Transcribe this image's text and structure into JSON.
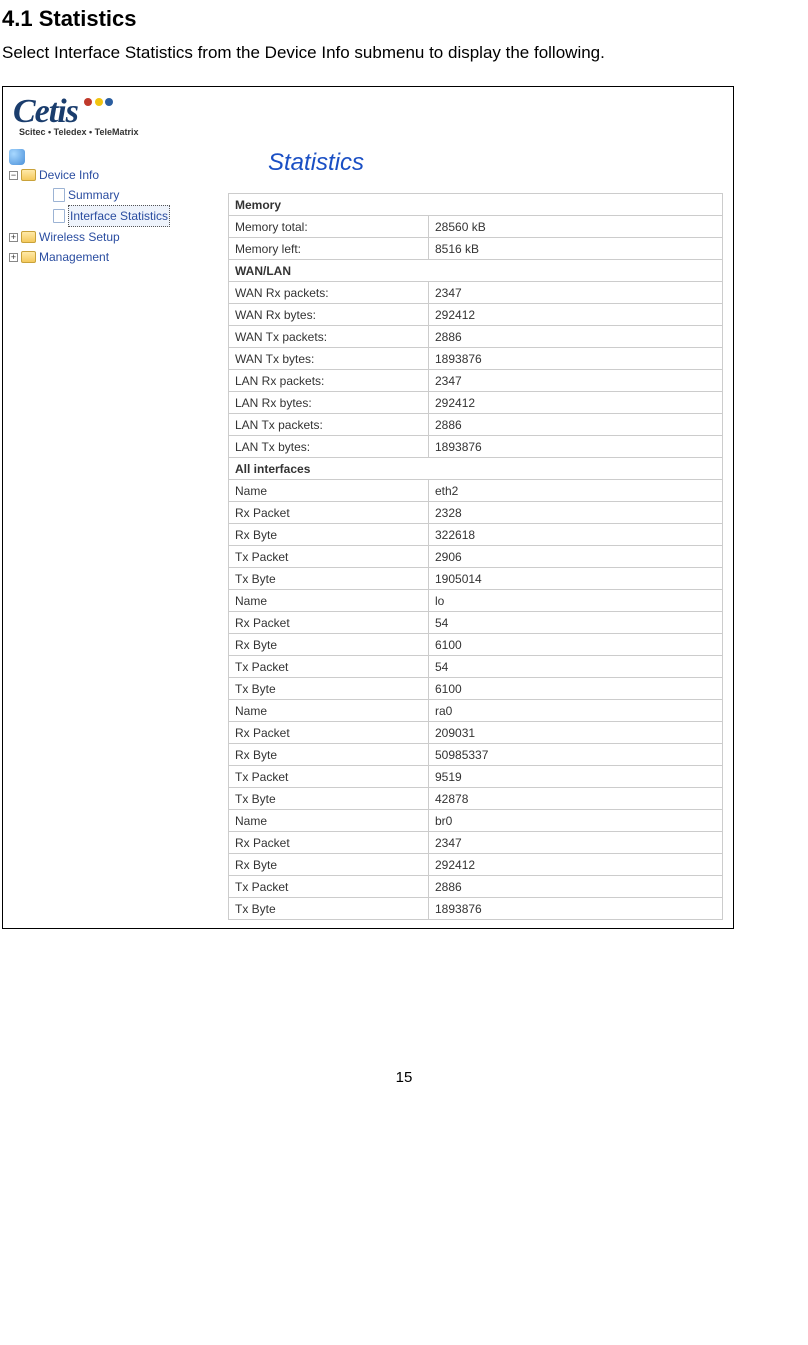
{
  "doc": {
    "heading": "4.1 Statistics",
    "intro": "Select Interface Statistics from the Device Info submenu to display the following.",
    "page_number": "15"
  },
  "logo": {
    "name": "Cetis",
    "sub": "Scitec • Teledex • TeleMatrix"
  },
  "sidebar": {
    "nodes": [
      {
        "label": "Device Info",
        "type": "folder-open",
        "expander": "−"
      },
      {
        "label": "Summary",
        "type": "doc",
        "indent": 2
      },
      {
        "label": "Interface Statistics",
        "type": "doc",
        "indent": 2,
        "selected": true
      },
      {
        "label": "Wireless Setup",
        "type": "folder-closed",
        "expander": "+"
      },
      {
        "label": "Management",
        "type": "folder-closed",
        "expander": "+"
      }
    ]
  },
  "stats": {
    "title": "Statistics",
    "sections": [
      {
        "title": "Memory",
        "rows": [
          {
            "label": "Memory total:",
            "value": "28560 kB"
          },
          {
            "label": "Memory left:",
            "value": "8516 kB"
          }
        ]
      },
      {
        "title": "WAN/LAN",
        "rows": [
          {
            "label": "WAN Rx packets:",
            "value": "2347"
          },
          {
            "label": "WAN Rx bytes:",
            "value": "292412"
          },
          {
            "label": "WAN Tx packets:",
            "value": "2886"
          },
          {
            "label": "WAN Tx bytes:",
            "value": "1893876"
          },
          {
            "label": "LAN Rx packets:",
            "value": "2347"
          },
          {
            "label": "LAN Rx bytes:",
            "value": "292412"
          },
          {
            "label": "LAN Tx packets:",
            "value": "2886"
          },
          {
            "label": "LAN Tx bytes:",
            "value": "1893876"
          }
        ]
      },
      {
        "title": "All interfaces",
        "rows": [
          {
            "label": "Name",
            "value": "eth2"
          },
          {
            "label": "Rx Packet",
            "value": "2328"
          },
          {
            "label": "Rx Byte",
            "value": "322618"
          },
          {
            "label": "Tx Packet",
            "value": "2906"
          },
          {
            "label": "Tx Byte",
            "value": "1905014"
          },
          {
            "label": "Name",
            "value": "lo"
          },
          {
            "label": "Rx Packet",
            "value": "54"
          },
          {
            "label": "Rx Byte",
            "value": "6100"
          },
          {
            "label": "Tx Packet",
            "value": "54"
          },
          {
            "label": "Tx Byte",
            "value": "6100"
          },
          {
            "label": "Name",
            "value": "ra0"
          },
          {
            "label": "Rx Packet",
            "value": "209031"
          },
          {
            "label": "Rx Byte",
            "value": "50985337"
          },
          {
            "label": "Tx Packet",
            "value": "9519"
          },
          {
            "label": "Tx Byte",
            "value": "42878"
          },
          {
            "label": "Name",
            "value": "br0"
          },
          {
            "label": "Rx Packet",
            "value": "2347"
          },
          {
            "label": "Rx Byte",
            "value": "292412"
          },
          {
            "label": "Tx Packet",
            "value": "2886"
          },
          {
            "label": "Tx Byte",
            "value": "1893876"
          }
        ]
      }
    ]
  }
}
